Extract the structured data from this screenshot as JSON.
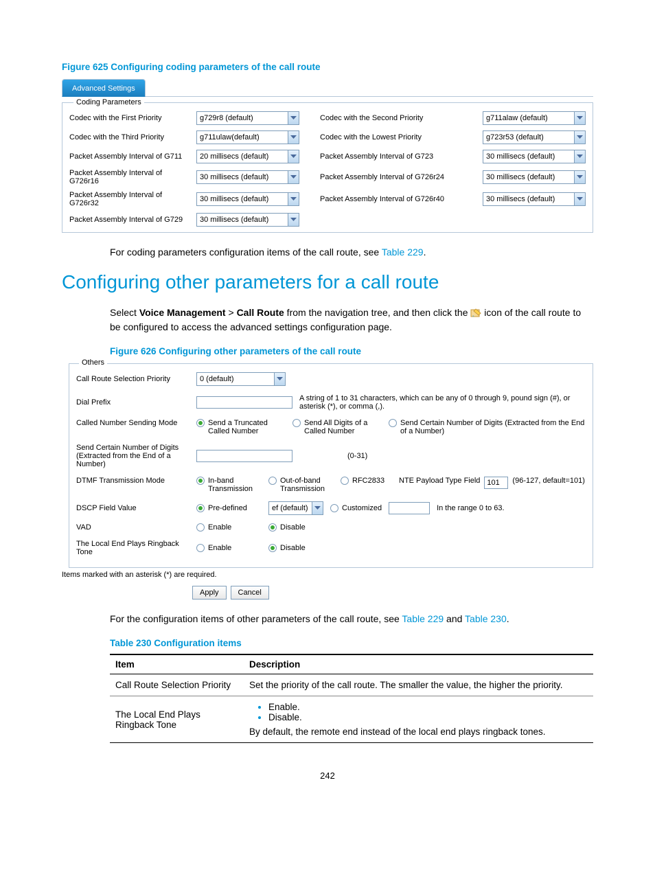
{
  "figure625": {
    "caption": "Figure 625 Configuring coding parameters of the call route",
    "tab": "Advanced Settings",
    "legend": "Coding Parameters",
    "rows": [
      {
        "l1": "Codec with the First Priority",
        "v1": "g729r8 (default)",
        "l2": "Codec with the Second Priority",
        "v2": "g711alaw (default)"
      },
      {
        "l1": "Codec with the Third Priority",
        "v1": "g711ulaw(default)",
        "l2": "Codec with the Lowest Priority",
        "v2": "g723r53 (default)"
      },
      {
        "l1": "Packet Assembly Interval of G711",
        "v1": "20 millisecs (default)",
        "l2": "Packet Assembly Interval of G723",
        "v2": "30 millisecs (default)"
      },
      {
        "l1": "Packet Assembly Interval of G726r16",
        "v1": "30 millisecs (default)",
        "l2": "Packet Assembly Interval of G726r24",
        "v2": "30 millisecs (default)"
      },
      {
        "l1": "Packet Assembly Interval of G726r32",
        "v1": "30 millisecs (default)",
        "l2": "Packet Assembly Interval of G726r40",
        "v2": "30 millisecs (default)"
      },
      {
        "l1": "Packet Assembly Interval of G729",
        "v1": "30 millisecs (default)",
        "l2": "",
        "v2": ""
      }
    ]
  },
  "para1a": "For coding parameters configuration items of the call route, see ",
  "para1b": "Table 229",
  "para1c": ".",
  "heading": "Configuring other parameters for a call route",
  "para2a": "Select ",
  "para2b": "Voice Management",
  "para2c": " > ",
  "para2d": "Call Route",
  "para2e": " from the navigation tree, and then click the ",
  "para2f": " icon of the call route to be configured to access the advanced settings configuration page.",
  "figure626": {
    "caption": "Figure 626 Configuring other parameters of the call route",
    "legend": "Others",
    "priority_label": "Call Route Selection Priority",
    "priority_value": "0 (default)",
    "dialprefix_label": "Dial Prefix",
    "dialprefix_hint": "A string of 1 to 31 characters, which can be any of 0 through 9, pound sign (#), or asterisk (*), or comma (,).",
    "sendmode_label": "Called Number Sending Mode",
    "sendmode_opt1": "Send a Truncated Called Number",
    "sendmode_opt2": "Send All Digits of a Called Number",
    "sendmode_opt3": "Send Certain Number of Digits (Extracted from the End of a Number)",
    "digits_label": "Send Certain Number of Digits (Extracted from the End of a Number)",
    "digits_hint": "(0-31)",
    "dtmf_label": "DTMF Transmission Mode",
    "dtmf_opt1": "In-band Transmission",
    "dtmf_opt2": "Out-of-band Transmission",
    "dtmf_opt3": "RFC2833",
    "dtmf_nte_label": "NTE Payload Type Field",
    "dtmf_nte_value": "101",
    "dtmf_nte_hint": "(96-127, default=101)",
    "dscp_label": "DSCP Field Value",
    "dscp_opt1": "Pre-defined",
    "dscp_sel": "ef (default)",
    "dscp_opt2": "Customized",
    "dscp_hint": "In the range 0 to 63.",
    "vad_label": "VAD",
    "ringback_label": "The Local End Plays Ringback Tone",
    "enable": "Enable",
    "disable": "Disable",
    "required": "Items marked with an asterisk (*) are required.",
    "apply": "Apply",
    "cancel": "Cancel"
  },
  "para3a": "For the configuration items of other parameters of the call route, see ",
  "para3b": "Table 229",
  "para3c": " and ",
  "para3d": "Table 230",
  "para3e": ".",
  "table230": {
    "caption": "Table 230 Configuration items",
    "th1": "Item",
    "th2": "Description",
    "r1c1": "Call Route Selection Priority",
    "r1c2": "Set the priority of the call route. The smaller the value, the higher the priority.",
    "r2c1": "The Local End Plays Ringback Tone",
    "r2li1": "Enable.",
    "r2li2": "Disable.",
    "r2c2b": "By default, the remote end instead of the local end plays ringback tones."
  },
  "pagenum": "242"
}
